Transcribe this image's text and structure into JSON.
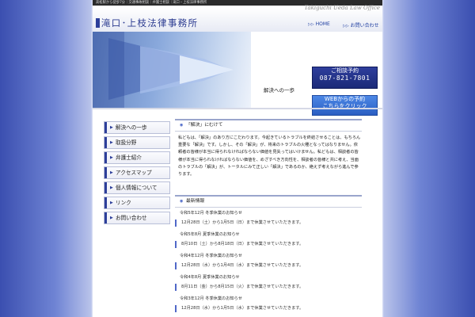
{
  "topbar": {
    "tagline": "高松駅から徒歩7分｜交通事故相談｜弁護士相談｜滝口・上枝法律事務所",
    "office_en": "Takiguchi Ueda Law Office"
  },
  "header": {
    "logo_text": "滝口･上枝法律事務所",
    "nav": [
      {
        "label": "HOME"
      },
      {
        "label": "お問い合わせ"
      }
    ]
  },
  "hero": {
    "cta_phone": {
      "line1": "ご相談予約",
      "line2": "087-821-7801"
    },
    "cta_web": {
      "line1": "WEBからの予約",
      "line2": "こちらをクリック"
    },
    "caption": "解決への一歩"
  },
  "sidebar": {
    "items": [
      {
        "label": "解決への一歩"
      },
      {
        "label": "取扱分野"
      },
      {
        "label": "弁護士紹介"
      },
      {
        "label": "アクセスマップ"
      },
      {
        "label": "個人情報について"
      },
      {
        "label": "リンク"
      },
      {
        "label": "お問い合わせ"
      }
    ]
  },
  "main": {
    "intro_heading": "「解決」にむけて",
    "intro_text": "私どもは、「解決」のあり方にこだわります。今起きているトラブルを終結させることは、もちろん重要な「解決」です。しかし、その「解決」が、将来のトラブルの火種となってはなりません。依頼者の皆様が本当に得られなければならない価値を見失ってはいけません。私どもは、相談者の皆様が本当に得られなければならない価値を、めざすべき方向性を、相談者の皆様と共に考え、当面のトラブルの「解決」が、トータルにみて正しい「解決」であるのか、絶えず考えながら進んで参ります。",
    "news_heading": "最新情報",
    "news": [
      {
        "title": "令和5年12月 冬季休業のお知らせ",
        "detail": "12月28日（土）から1月5日（日）まで休業させていただきます。"
      },
      {
        "title": "令和5年8月 夏季休業のお知らせ",
        "detail": "8月10日（土）から8月18日（日）まで休業させていただきます。"
      },
      {
        "title": "令和4年12月 冬季休業のお知らせ",
        "detail": "12月28日（水）から1月4日（水）まで休業させていただきます。"
      },
      {
        "title": "令和4年8月 夏季休業のお知らせ",
        "detail": "8月11日（金）から8月15日（火）まで休業させていただきます。"
      },
      {
        "title": "令和3年12月 冬季休業のお知らせ",
        "detail": "12月28日（水）から1月5日（水）まで休業させていただきます。"
      }
    ]
  },
  "colors": {
    "accent": "#2d3f9a",
    "cta_phone": "#1f2f85",
    "cta_web": "#3a72d8",
    "page_bg_side": "#3b4fb0"
  }
}
